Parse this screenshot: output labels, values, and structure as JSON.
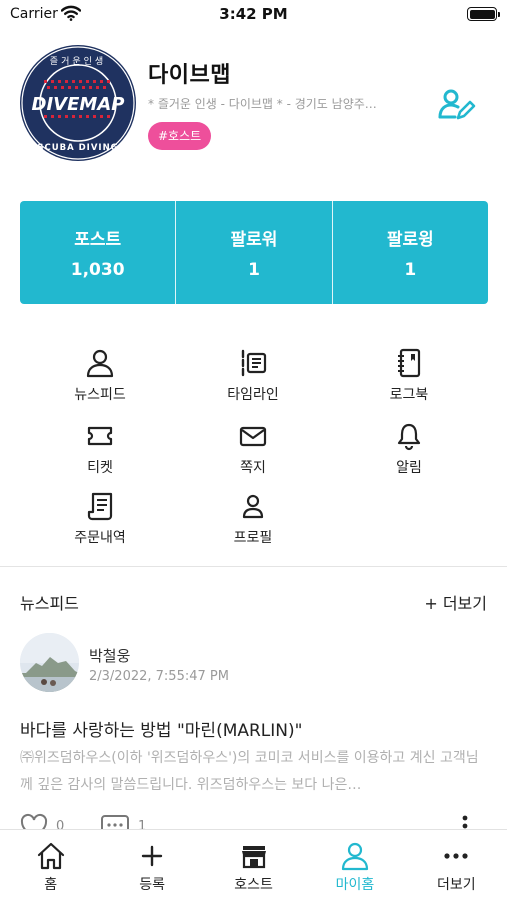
{
  "status_bar": {
    "carrier": "Carrier",
    "time": "3:42 PM"
  },
  "logo": {
    "top_text": "즐거운인생",
    "brand": "DIVEMAP",
    "bottom_text": "SCUBA DIVING",
    "colors": {
      "ring": "#1f3260",
      "accent": "#d8243a"
    }
  },
  "profile": {
    "name": "다이브맵",
    "description": "* 즐거운 인생 - 다이브맵 *  - 경기도 남양주…",
    "badge": "#호스트",
    "edit_icon": "user-edit-icon"
  },
  "stats": [
    {
      "label": "포스트",
      "value": "1,030"
    },
    {
      "label": "팔로워",
      "value": "1"
    },
    {
      "label": "팔로윙",
      "value": "1"
    }
  ],
  "menu": {
    "newsfeed": "뉴스피드",
    "timeline": "타임라인",
    "logbook": "로그북",
    "ticket": "티켓",
    "message": "쪽지",
    "alarm": "알림",
    "orders": "주문내역",
    "profile": "프로필"
  },
  "feed": {
    "title": "뉴스피드",
    "more": "+ 더보기",
    "post": {
      "author": "박철웅",
      "date": "2/3/2022, 7:55:47 PM",
      "title": "바다를 사랑하는 방법 \"마린(MARLIN)\"",
      "excerpt": "㈜위즈덤하우스(이하 '위즈덤하우스')의 코미코 서비스를 이용하고 계신 고객님께 깊은 감사의 말씀드립니다. 위즈덤하우스는 보다 나은…",
      "likes": "0",
      "comments": "1"
    }
  },
  "tabs": [
    {
      "label": "홈",
      "icon": "home-icon",
      "active": false
    },
    {
      "label": "등록",
      "icon": "plus-icon",
      "active": false
    },
    {
      "label": "호스트",
      "icon": "store-icon",
      "active": false
    },
    {
      "label": "마이홈",
      "icon": "user-icon",
      "active": true
    },
    {
      "label": "더보기",
      "icon": "more-dots-icon",
      "active": false
    }
  ],
  "colors": {
    "accent": "#22b8cf",
    "badge": "#ee4f9b",
    "muted_text": "#9a9a9a"
  }
}
